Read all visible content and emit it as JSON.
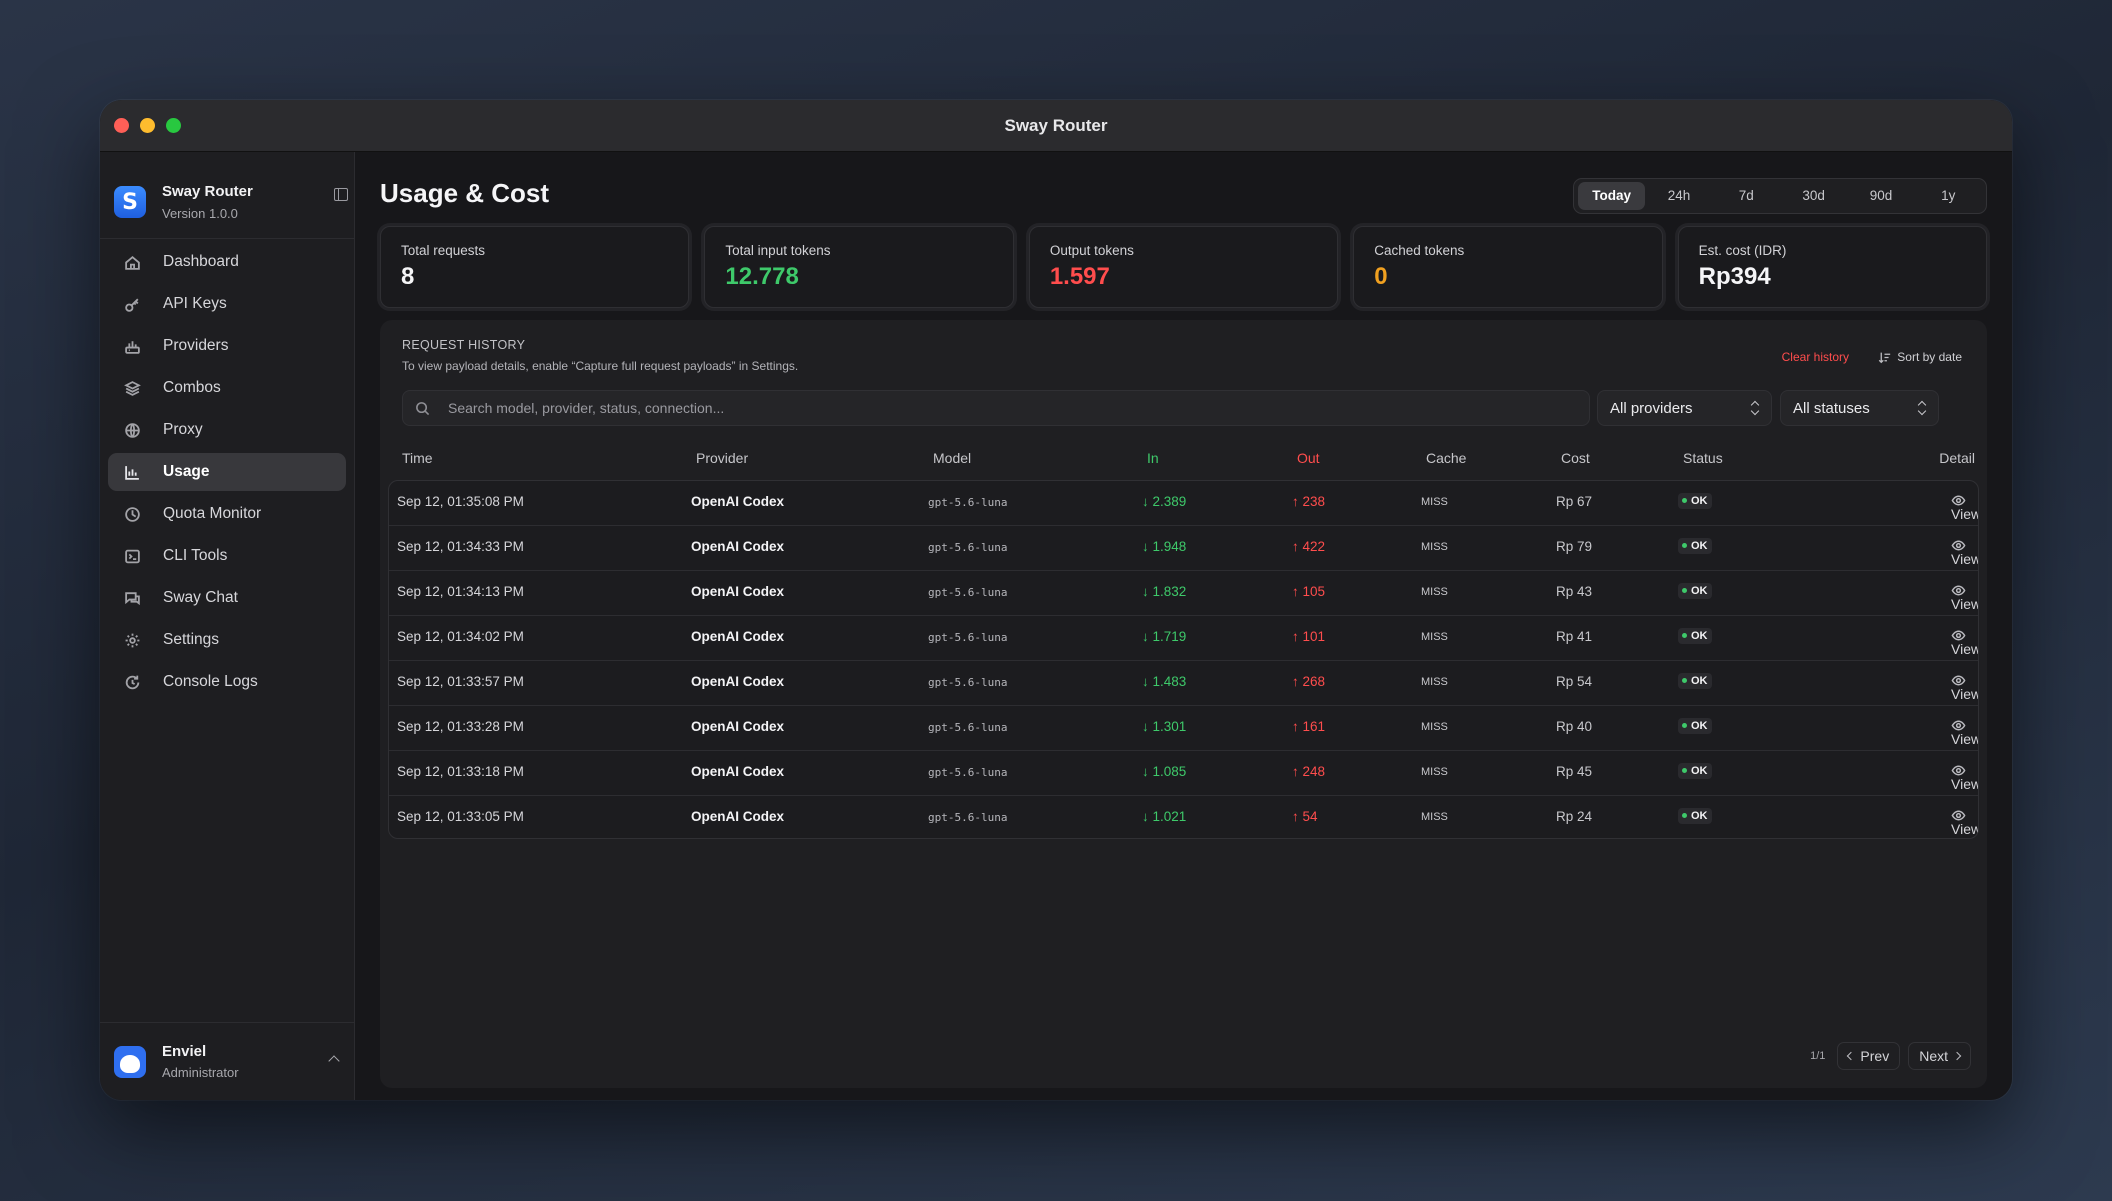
{
  "window": {
    "title": "Sway Router"
  },
  "brand": {
    "name": "Sway Router",
    "version": "Version 1.0.0"
  },
  "sidebar": {
    "items": [
      {
        "label": "Dashboard",
        "icon": "home-icon"
      },
      {
        "label": "API Keys",
        "icon": "key-icon"
      },
      {
        "label": "Providers",
        "icon": "router-icon"
      },
      {
        "label": "Combos",
        "icon": "layers-icon"
      },
      {
        "label": "Proxy",
        "icon": "globe-icon"
      },
      {
        "label": "Usage",
        "icon": "bar-chart-icon",
        "active": true
      },
      {
        "label": "Quota Monitor",
        "icon": "pie-clock-icon"
      },
      {
        "label": "CLI Tools",
        "icon": "terminal-icon"
      },
      {
        "label": "Sway Chat",
        "icon": "chat-icon"
      },
      {
        "label": "Settings",
        "icon": "gear-icon"
      },
      {
        "label": "Console Logs",
        "icon": "refresh-log-icon"
      }
    ]
  },
  "user": {
    "name": "Enviel",
    "role": "Administrator"
  },
  "page": {
    "title": "Usage & Cost"
  },
  "ranges": [
    "Today",
    "24h",
    "7d",
    "30d",
    "90d",
    "1y"
  ],
  "active_range": "Today",
  "stats": [
    {
      "label": "Total requests",
      "value": "8",
      "color": "#f5f5f7"
    },
    {
      "label": "Total input tokens",
      "value": "12.778",
      "color": "#3ec96a"
    },
    {
      "label": "Output tokens",
      "value": "1.597",
      "color": "#ff4d4d"
    },
    {
      "label": "Cached tokens",
      "value": "0",
      "color": "#f0a020"
    },
    {
      "label": "Est. cost (IDR)",
      "value": "Rp394",
      "color": "#f5f5f7"
    }
  ],
  "history": {
    "title": "REQUEST HISTORY",
    "subtitle": "To view payload details, enable “Capture full request payloads” in Settings.",
    "clear_label": "Clear history",
    "sort_label": "Sort by date",
    "search_placeholder": "Search model, provider, status, connection...",
    "provider_filter": "All providers",
    "status_filter": "All statuses",
    "columns": {
      "time": "Time",
      "provider": "Provider",
      "model": "Model",
      "in": "In",
      "out": "Out",
      "cache": "Cache",
      "cost": "Cost",
      "status": "Status",
      "detail": "Detail"
    },
    "rows": [
      {
        "time": "Sep 12, 01:35:08 PM",
        "provider": "OpenAI Codex",
        "model": "gpt-5.6-luna",
        "in": "↓ 2.389",
        "out": "↑ 238",
        "cache": "MISS",
        "cost": "Rp 67",
        "status": "OK",
        "detail": "View"
      },
      {
        "time": "Sep 12, 01:34:33 PM",
        "provider": "OpenAI Codex",
        "model": "gpt-5.6-luna",
        "in": "↓ 1.948",
        "out": "↑ 422",
        "cache": "MISS",
        "cost": "Rp 79",
        "status": "OK",
        "detail": "View"
      },
      {
        "time": "Sep 12, 01:34:13 PM",
        "provider": "OpenAI Codex",
        "model": "gpt-5.6-luna",
        "in": "↓ 1.832",
        "out": "↑ 105",
        "cache": "MISS",
        "cost": "Rp 43",
        "status": "OK",
        "detail": "View"
      },
      {
        "time": "Sep 12, 01:34:02 PM",
        "provider": "OpenAI Codex",
        "model": "gpt-5.6-luna",
        "in": "↓ 1.719",
        "out": "↑ 101",
        "cache": "MISS",
        "cost": "Rp 41",
        "status": "OK",
        "detail": "View"
      },
      {
        "time": "Sep 12, 01:33:57 PM",
        "provider": "OpenAI Codex",
        "model": "gpt-5.6-luna",
        "in": "↓ 1.483",
        "out": "↑ 268",
        "cache": "MISS",
        "cost": "Rp 54",
        "status": "OK",
        "detail": "View"
      },
      {
        "time": "Sep 12, 01:33:28 PM",
        "provider": "OpenAI Codex",
        "model": "gpt-5.6-luna",
        "in": "↓ 1.301",
        "out": "↑ 161",
        "cache": "MISS",
        "cost": "Rp 40",
        "status": "OK",
        "detail": "View"
      },
      {
        "time": "Sep 12, 01:33:18 PM",
        "provider": "OpenAI Codex",
        "model": "gpt-5.6-luna",
        "in": "↓ 1.085",
        "out": "↑ 248",
        "cache": "MISS",
        "cost": "Rp 45",
        "status": "OK",
        "detail": "View"
      },
      {
        "time": "Sep 12, 01:33:05 PM",
        "provider": "OpenAI Codex",
        "model": "gpt-5.6-luna",
        "in": "↓ 1.021",
        "out": "↑ 54",
        "cache": "MISS",
        "cost": "Rp 24",
        "status": "OK",
        "detail": "View"
      }
    ]
  },
  "pagination": {
    "info": "1/1",
    "prev": "Prev",
    "next": "Next"
  },
  "colors": {
    "accent_green": "#3ec96a",
    "accent_red": "#ff4d4d",
    "accent_orange": "#f0a020",
    "brand_blue": "#2f6ff0"
  }
}
